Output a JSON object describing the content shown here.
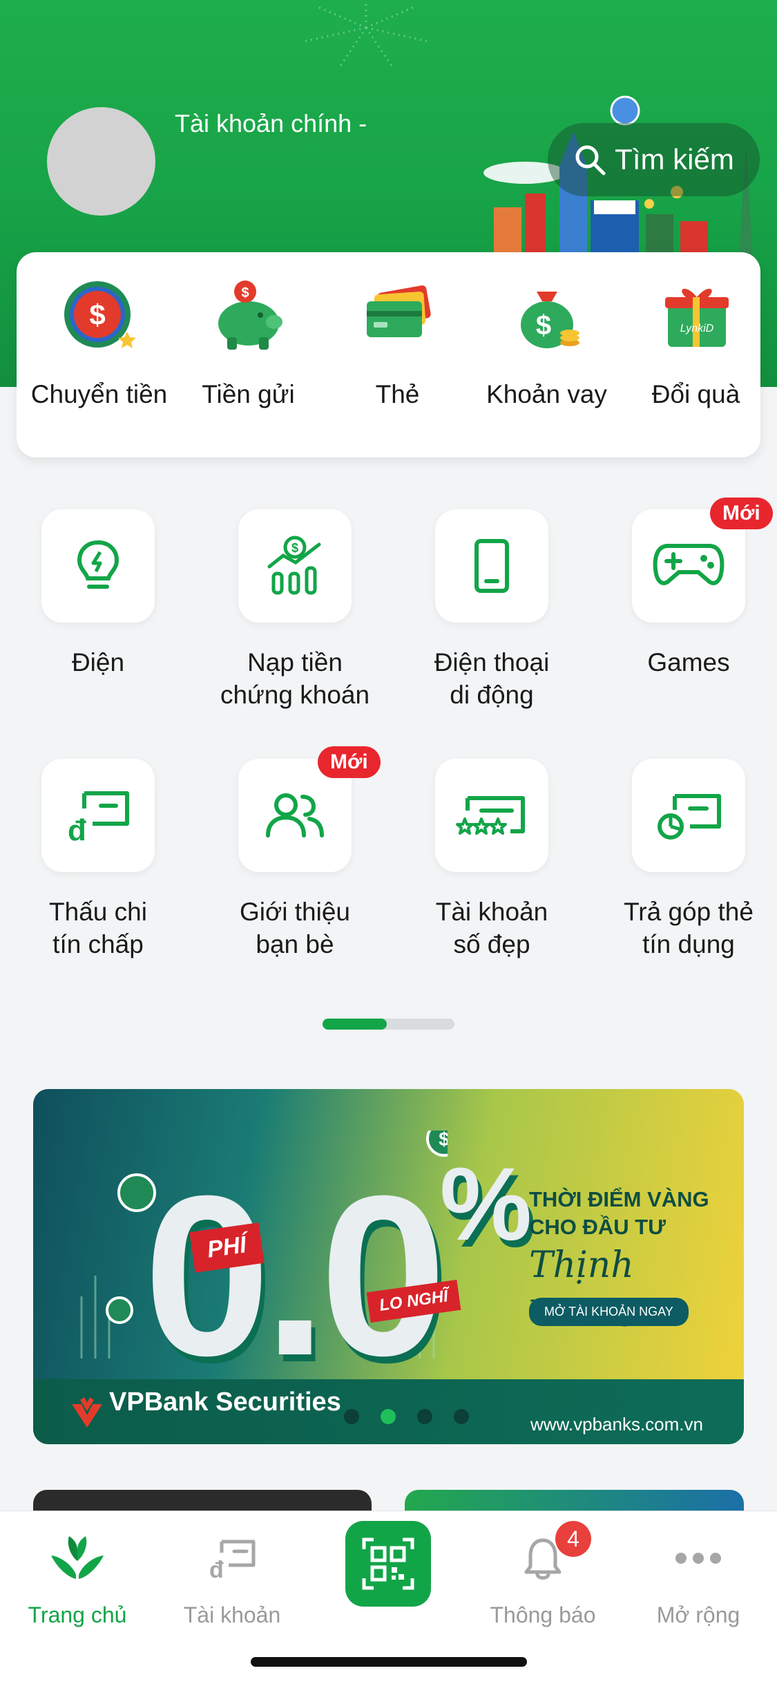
{
  "header": {
    "account_title": "Tài khoản chính -",
    "search_label": "Tìm kiếm"
  },
  "quick_actions": [
    {
      "label": "Chuyển tiền",
      "icon": "transfer-coin-icon"
    },
    {
      "label": "Tiền gửi",
      "icon": "piggy-bank-icon"
    },
    {
      "label": "Thẻ",
      "icon": "cards-icon"
    },
    {
      "label": "Khoản vay",
      "icon": "money-bag-icon"
    },
    {
      "label": "Đổi quà",
      "icon": "gift-box-icon"
    }
  ],
  "services": [
    {
      "label_line1": "Điện",
      "label_line2": "",
      "icon": "lightbulb-icon"
    },
    {
      "label_line1": "Nạp tiền",
      "label_line2": "chứng khoán",
      "icon": "stock-topup-icon"
    },
    {
      "label_line1": "Điện thoại",
      "label_line2": "di động",
      "icon": "mobile-phone-icon"
    },
    {
      "label_line1": "Games",
      "label_line2": "",
      "icon": "gamepad-icon",
      "badge": "Mới"
    },
    {
      "label_line1": "Thấu chi",
      "label_line2": "tín chấp",
      "icon": "overdraft-card-icon"
    },
    {
      "label_line1": "Giới thiệu",
      "label_line2": "bạn bè",
      "icon": "refer-friends-icon",
      "badge": "Mới"
    },
    {
      "label_line1": "Tài khoản",
      "label_line2": "số đẹp",
      "icon": "vip-number-card-icon"
    },
    {
      "label_line1": "Trả góp thẻ",
      "label_line2": "tín dụng",
      "icon": "installment-card-icon"
    }
  ],
  "services_pager": {
    "pages": 2,
    "current": 1
  },
  "banner": {
    "zero_text": "0.0",
    "percent": "%",
    "phi_tag": "PHÍ",
    "lonau_tag": "LO NGHĨ",
    "headline_line1": "THỜI ĐIỂM VÀNG",
    "headline_line2": "CHO ĐẦU TƯ",
    "script_text": "Thịnh vượng",
    "cta": "MỞ TÀI KHOẢN NGAY",
    "brand": "VPBank Securities",
    "url": "www.vpbanks.com.vn",
    "slide_count": 4,
    "active_slide": 2
  },
  "tabbar": {
    "home": "Trang chủ",
    "account": "Tài khoản",
    "notifications": "Thông báo",
    "notifications_count": "4",
    "more": "Mở rộng"
  },
  "colors": {
    "brand_green": "#12a548",
    "badge_red": "#e8262e"
  }
}
